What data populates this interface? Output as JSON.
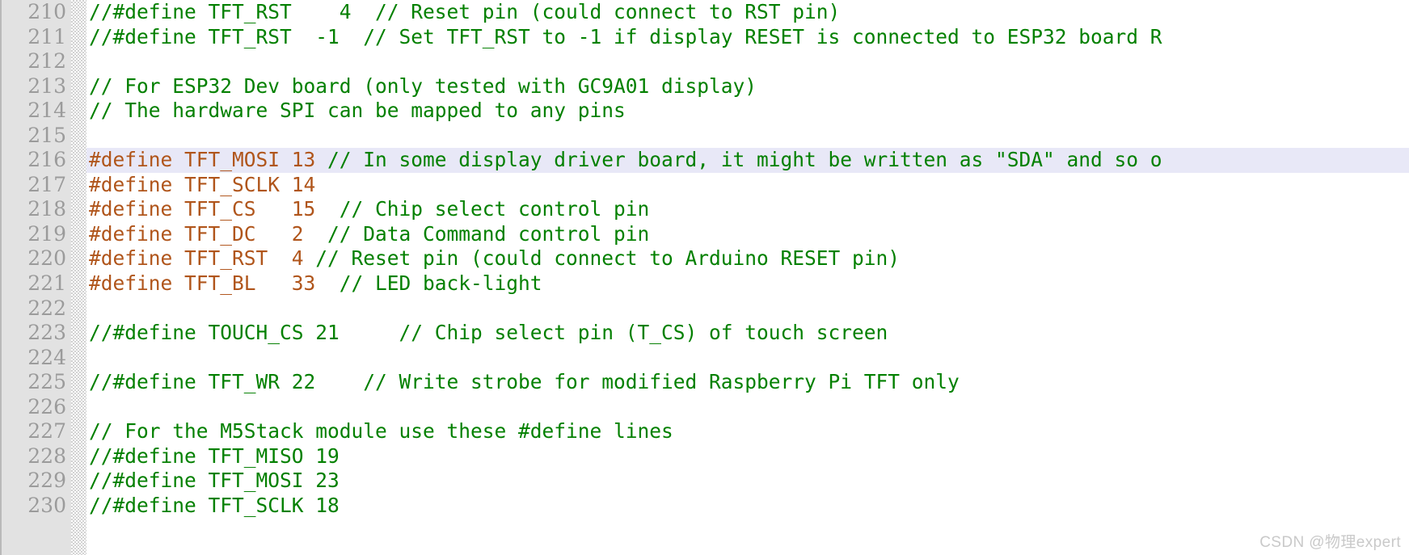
{
  "editor": {
    "kind": "code-editor",
    "language": "cpp",
    "first_line_number": 210,
    "highlighted_line_number": 216,
    "colors": {
      "background": "#ffffff",
      "gutter_background": "#e2e2e2",
      "line_number": "#9b9b9b",
      "comment": "#038000",
      "preprocessor": "#b0551b",
      "current_line_highlight": "#e8e8f7",
      "watermark": "#c9c9c9"
    }
  },
  "watermark": {
    "text": "CSDN @物理expert"
  },
  "lines": [
    {
      "number": "210",
      "highlighted": false,
      "tokens": [
        {
          "type": "comment",
          "text": "//#define TFT_RST    4  // Reset pin (could connect to RST pin)"
        }
      ]
    },
    {
      "number": "211",
      "highlighted": false,
      "tokens": [
        {
          "type": "comment",
          "text": "//#define TFT_RST  -1  // Set TFT_RST to -1 if display RESET is connected to ESP32 board R"
        }
      ]
    },
    {
      "number": "212",
      "highlighted": false,
      "tokens": [
        {
          "type": "plain",
          "text": ""
        }
      ]
    },
    {
      "number": "213",
      "highlighted": false,
      "tokens": [
        {
          "type": "comment",
          "text": "// For ESP32 Dev board (only tested with GC9A01 display)"
        }
      ]
    },
    {
      "number": "214",
      "highlighted": false,
      "tokens": [
        {
          "type": "comment",
          "text": "// The hardware SPI can be mapped to any pins"
        }
      ]
    },
    {
      "number": "215",
      "highlighted": false,
      "tokens": [
        {
          "type": "plain",
          "text": ""
        }
      ]
    },
    {
      "number": "216",
      "highlighted": true,
      "tokens": [
        {
          "type": "pre",
          "text": "#define TFT_MOSI 13 "
        },
        {
          "type": "comment",
          "text": "// In some display driver board, it might be written as \"SDA\" and so o"
        }
      ]
    },
    {
      "number": "217",
      "highlighted": false,
      "tokens": [
        {
          "type": "pre",
          "text": "#define TFT_SCLK 14"
        }
      ]
    },
    {
      "number": "218",
      "highlighted": false,
      "tokens": [
        {
          "type": "pre",
          "text": "#define TFT_CS   15  "
        },
        {
          "type": "comment",
          "text": "// Chip select control pin"
        }
      ]
    },
    {
      "number": "219",
      "highlighted": false,
      "tokens": [
        {
          "type": "pre",
          "text": "#define TFT_DC   2  "
        },
        {
          "type": "comment",
          "text": "// Data Command control pin"
        }
      ]
    },
    {
      "number": "220",
      "highlighted": false,
      "tokens": [
        {
          "type": "pre",
          "text": "#define TFT_RST  4 "
        },
        {
          "type": "comment",
          "text": "// Reset pin (could connect to Arduino RESET pin)"
        }
      ]
    },
    {
      "number": "221",
      "highlighted": false,
      "tokens": [
        {
          "type": "pre",
          "text": "#define TFT_BL   33  "
        },
        {
          "type": "comment",
          "text": "// LED back-light"
        }
      ]
    },
    {
      "number": "222",
      "highlighted": false,
      "tokens": [
        {
          "type": "plain",
          "text": ""
        }
      ]
    },
    {
      "number": "223",
      "highlighted": false,
      "tokens": [
        {
          "type": "comment",
          "text": "//#define TOUCH_CS 21     // Chip select pin (T_CS) of touch screen"
        }
      ]
    },
    {
      "number": "224",
      "highlighted": false,
      "tokens": [
        {
          "type": "plain",
          "text": ""
        }
      ]
    },
    {
      "number": "225",
      "highlighted": false,
      "tokens": [
        {
          "type": "comment",
          "text": "//#define TFT_WR 22    // Write strobe for modified Raspberry Pi TFT only"
        }
      ]
    },
    {
      "number": "226",
      "highlighted": false,
      "tokens": [
        {
          "type": "plain",
          "text": ""
        }
      ]
    },
    {
      "number": "227",
      "highlighted": false,
      "tokens": [
        {
          "type": "comment",
          "text": "// For the M5Stack module use these #define lines"
        }
      ]
    },
    {
      "number": "228",
      "highlighted": false,
      "tokens": [
        {
          "type": "comment",
          "text": "//#define TFT_MISO 19"
        }
      ]
    },
    {
      "number": "229",
      "highlighted": false,
      "tokens": [
        {
          "type": "comment",
          "text": "//#define TFT_MOSI 23"
        }
      ]
    },
    {
      "number": "230",
      "highlighted": false,
      "tokens": [
        {
          "type": "comment",
          "text": "//#define TFT_SCLK 18"
        }
      ]
    }
  ]
}
